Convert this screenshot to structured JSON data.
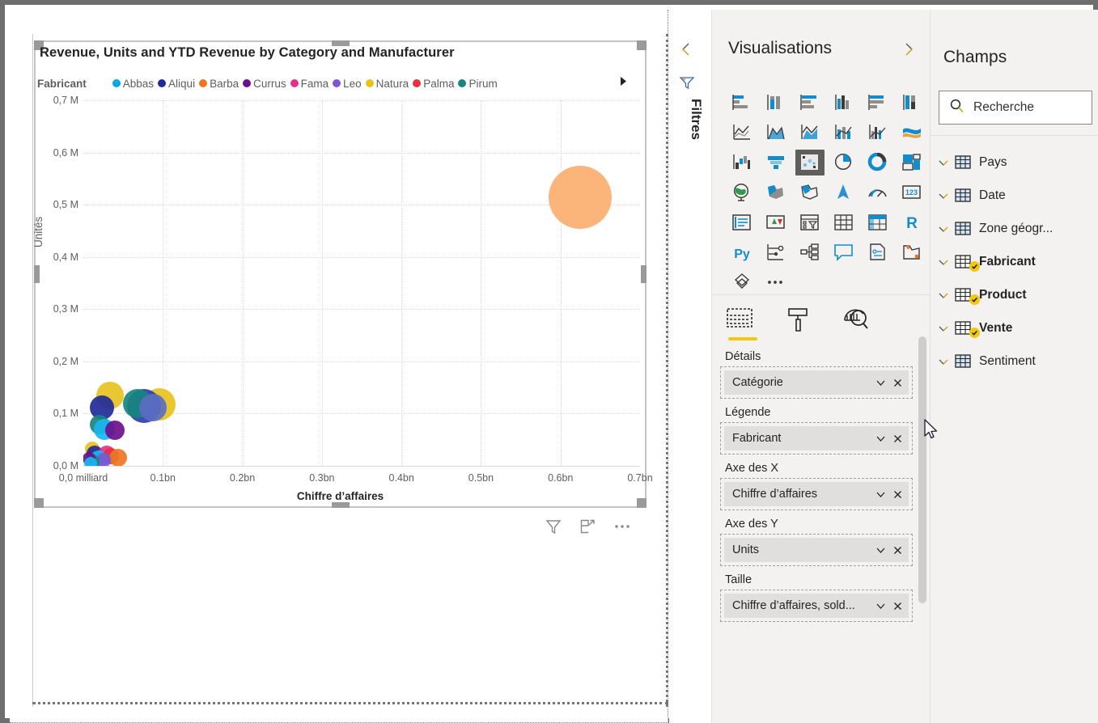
{
  "visual": {
    "title": "Revenue, Units and YTD Revenue by Category and Manufacturer",
    "legend_title": "Fabricant",
    "legend_next_icon": "chevron-right",
    "actions": [
      "filter-icon",
      "focus-mode-icon",
      "more-options-icon"
    ]
  },
  "chart_data": {
    "type": "scatter",
    "title": "Revenue, Units and YTD Revenue by Category and Manufacturer",
    "xlabel": "Chiffre d’affaires",
    "ylabel": "Unités",
    "legend_title": "Fabricant",
    "legend_position": "top",
    "grid": true,
    "xlim": [
      0,
      0.7
    ],
    "ylim": [
      0,
      700000
    ],
    "x_ticks": [
      "0,0 milliard",
      "0.1bn",
      "0.2bn",
      "0.3bn",
      "0.4bn",
      "0.5bn",
      "0.6bn",
      "0.7bn"
    ],
    "x_tick_values": [
      0,
      0.1,
      0.2,
      0.3,
      0.4,
      0.5,
      0.6,
      0.7
    ],
    "y_ticks": [
      "0,0 M",
      "0,1 M",
      "0,2 M",
      "0,3 M",
      "0,4 M",
      "0,5 M",
      "0,6 M",
      "0,7 M"
    ],
    "y_tick_values": [
      0,
      100000,
      200000,
      300000,
      400000,
      500000,
      600000,
      700000
    ],
    "legend": [
      {
        "name": "Abbas",
        "color": "#00A8E8"
      },
      {
        "name": "Aliqui",
        "color": "#1F2A99"
      },
      {
        "name": "Barba",
        "color": "#EE7623"
      },
      {
        "name": "Currus",
        "color": "#6B0F8C"
      },
      {
        "name": "Fama",
        "color": "#E8308A"
      },
      {
        "name": "Leo",
        "color": "#7B57D2"
      },
      {
        "name": "Natura",
        "color": "#E8C21E"
      },
      {
        "name": "Palma",
        "color": "#E5323B"
      },
      {
        "name": "Pirum",
        "color": "#17867F"
      }
    ],
    "points": [
      {
        "manufacturer": "Barba",
        "color": "#FBAE6E",
        "x": 0.625,
        "y": 0.735,
        "r": 39,
        "note": "clipped at top of plot"
      },
      {
        "manufacturer": "Natura",
        "color": "#E8C21E",
        "x": 0.0335,
        "y": 0.193,
        "r": 17
      },
      {
        "manufacturer": "Natura",
        "color": "#E8C21E",
        "x": 0.0955,
        "y": 0.168,
        "r": 20
      },
      {
        "manufacturer": "Aliqui",
        "color": "#1F2A99",
        "x": 0.0235,
        "y": 0.16,
        "r": 15
      },
      {
        "manufacturer": "Aliqui",
        "color": "#2B3FA8",
        "x": 0.0765,
        "y": 0.163,
        "r": 21
      },
      {
        "manufacturer": "Pirum",
        "color": "#17867F",
        "x": 0.0685,
        "y": 0.171,
        "r": 18
      },
      {
        "manufacturer": "Leo",
        "color": "#5C6CC4",
        "x": 0.0875,
        "y": 0.16,
        "r": 17
      },
      {
        "manufacturer": "Pirum",
        "color": "#17867F",
        "x": 0.0205,
        "y": 0.112,
        "r": 12
      },
      {
        "manufacturer": "Abbas",
        "color": "#19B6F0",
        "x": 0.0265,
        "y": 0.1,
        "r": 13
      },
      {
        "manufacturer": "Currus",
        "color": "#6B0F8C",
        "x": 0.0395,
        "y": 0.097,
        "r": 12
      },
      {
        "manufacturer": "Natura",
        "color": "#E8C21E",
        "x": 0.0115,
        "y": 0.046,
        "r": 9
      },
      {
        "manufacturer": "Aliqui",
        "color": "#1F2A99",
        "x": 0.0145,
        "y": 0.033,
        "r": 10
      },
      {
        "manufacturer": "Fama",
        "color": "#E8308A",
        "x": 0.0295,
        "y": 0.03,
        "r": 11
      },
      {
        "manufacturer": "Palma",
        "color": "#E5323B",
        "x": 0.0345,
        "y": 0.026,
        "r": 10
      },
      {
        "manufacturer": "Barba",
        "color": "#EE7623",
        "x": 0.0435,
        "y": 0.022,
        "r": 11
      },
      {
        "manufacturer": "Abbas",
        "color": "#19B6F0",
        "x": 0.0195,
        "y": 0.018,
        "r": 11
      },
      {
        "manufacturer": "Leo",
        "color": "#7B57D2",
        "x": 0.0255,
        "y": 0.016,
        "r": 9
      },
      {
        "manufacturer": "Pirum",
        "color": "#17867F",
        "x": 0.0115,
        "y": 0.012,
        "r": 9
      },
      {
        "manufacturer": "Currus",
        "color": "#6B0F8C",
        "x": 0.0075,
        "y": 0.02,
        "r": 8
      },
      {
        "manufacturer": "Abbas",
        "color": "#19B6F0",
        "x": 0.0095,
        "y": 0.006,
        "r": 8
      }
    ]
  },
  "filters_rail": {
    "collapse_icon": "chevron-left",
    "filter_icon": "filter-funnel-icon",
    "label": "Filtres"
  },
  "visualisations": {
    "title": "Visualisations",
    "expand_icon": "chevron-right",
    "icons": [
      "stacked-bar-chart-icon",
      "stacked-column-chart-icon",
      "clustered-bar-chart-icon",
      "clustered-column-chart-icon",
      "100-stacked-bar-chart-icon",
      "100-stacked-column-chart-icon",
      "line-chart-icon",
      "area-chart-icon",
      "stacked-area-chart-icon",
      "line-stacked-column-chart-icon",
      "line-clustered-column-chart-icon",
      "ribbon-chart-icon",
      "waterfall-chart-icon",
      "funnel-chart-icon",
      "scatter-chart-icon",
      "pie-chart-icon",
      "donut-chart-icon",
      "treemap-icon",
      "map-icon",
      "filled-map-icon",
      "shape-map-icon",
      "arcgis-map-icon",
      "gauge-icon",
      "card-icon",
      "multi-row-card-icon",
      "kpi-icon",
      "slicer-icon",
      "table-icon",
      "matrix-icon",
      "r-script-visual-icon",
      "python-visual-icon",
      "key-influencers-icon",
      "decomposition-tree-icon",
      "qa-visual-icon",
      "smart-narrative-icon",
      "paginated-report-icon",
      "power-apps-icon",
      "more-visuals-icon"
    ],
    "selected_icon": "scatter-chart-icon",
    "well_tabs": [
      {
        "name": "fields-tab",
        "icon": "fields-pane-icon",
        "active": true
      },
      {
        "name": "format-tab",
        "icon": "paint-roller-icon",
        "active": false
      },
      {
        "name": "analytics-tab",
        "icon": "analytics-magnifier-icon",
        "active": false
      }
    ],
    "wells": [
      {
        "label": "Détails",
        "value": "Catégorie"
      },
      {
        "label": "Légende",
        "value": "Fabricant"
      },
      {
        "label": "Axe des X",
        "value": "Chiffre d’affaires"
      },
      {
        "label": "Axe des Y",
        "value": "Units"
      },
      {
        "label": "Taille",
        "value": "Chiffre d’affaires, sold..."
      }
    ]
  },
  "fields": {
    "title": "Champs",
    "search_placeholder": "Recherche",
    "search_value": "",
    "search_icon": "search-icon",
    "tables": [
      {
        "name": "Pays",
        "used": false
      },
      {
        "name": "Date",
        "used": false
      },
      {
        "name": "Zone géogr...",
        "used": false
      },
      {
        "name": "Fabricant",
        "used": true
      },
      {
        "name": "Product",
        "used": true
      },
      {
        "name": "Vente",
        "used": true
      },
      {
        "name": "Sentiment",
        "used": false
      }
    ]
  },
  "colors": {
    "accent_yellow": "#f2c811",
    "pane_bg": "#f3f2f1",
    "chip_bg": "#e1dfdd",
    "text": "#252423",
    "muted_text": "#605e5c"
  }
}
